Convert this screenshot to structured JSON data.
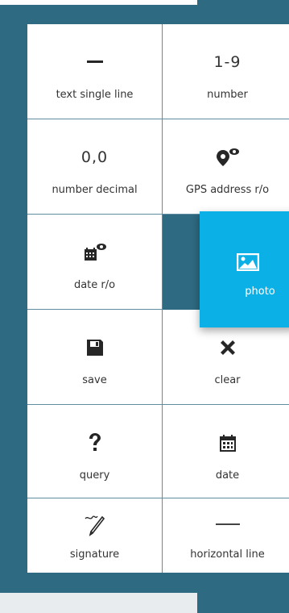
{
  "cells": {
    "text_single_line": {
      "icon": "horizontal-dash-icon",
      "label": "text single line"
    },
    "number": {
      "icon_text": "1-9",
      "label": "number"
    },
    "number_decimal": {
      "icon_text": "0,0",
      "label": "number decimal"
    },
    "gps_address": {
      "icon": "map-marker-eye-icon",
      "label": "GPS address r/o"
    },
    "date_ro": {
      "icon": "calendar-eye-icon",
      "label": "date r/o"
    },
    "photo": {
      "icon": "image-icon",
      "label": "photo"
    },
    "save": {
      "icon": "floppy-disk-icon",
      "label": "save"
    },
    "clear": {
      "icon": "x-icon",
      "label": "clear"
    },
    "query": {
      "icon": "question-mark-icon",
      "label": "query"
    },
    "date": {
      "icon": "calendar-icon",
      "label": "date"
    },
    "signature": {
      "icon": "pen-signature-icon",
      "label": "signature"
    },
    "horizontal_line": {
      "icon": "horizontal-line-icon",
      "label": "horizontal line"
    }
  },
  "colors": {
    "background": "#2e6a82",
    "accent": "#0bb0e6",
    "cell_border": "#5f8ea3"
  }
}
